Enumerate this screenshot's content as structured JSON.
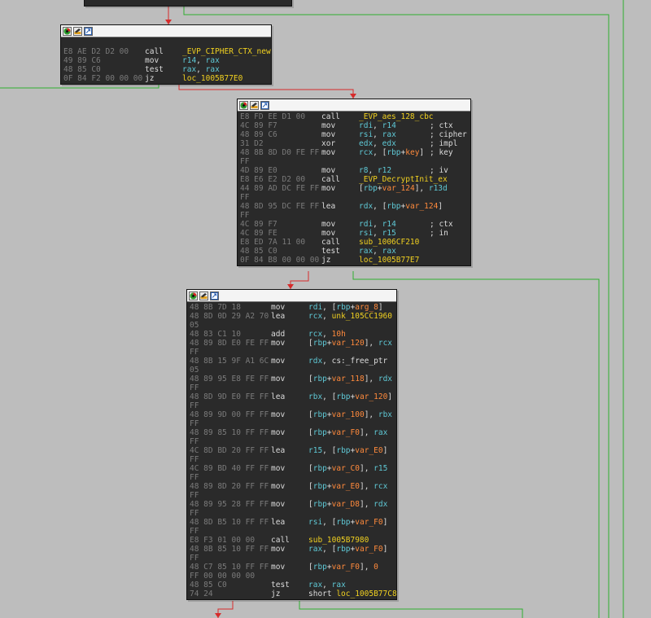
{
  "colors": {
    "background": "#bdbdbd",
    "node_bg": "#2a2a2a",
    "edge_true": "#2fae2f",
    "edge_false": "#d62b2b",
    "func": "#f0d020",
    "register": "#5fc9d6",
    "variable": "#ff8a3c",
    "bytes": "#7b7b7b"
  },
  "header_icons": [
    "color-node-icon",
    "rename-node-icon",
    "collapse-node-icon"
  ],
  "nodes": [
    {
      "lines": [
        {
          "b": "",
          "m": "",
          "o": [],
          "c": ""
        },
        {
          "b": "E8 AE D2 D2 00",
          "m": "call",
          "o": [
            {
              "t": "_EVP_CIPHER_CTX_new",
              "k": "func"
            }
          ],
          "c": ""
        },
        {
          "b": "49 89 C6",
          "m": "mov",
          "o": [
            {
              "t": "r14",
              "k": "reg"
            },
            {
              "t": ", ",
              "k": "text"
            },
            {
              "t": "rax",
              "k": "reg"
            }
          ],
          "c": ""
        },
        {
          "b": "48 85 C0",
          "m": "test",
          "o": [
            {
              "t": "rax",
              "k": "reg"
            },
            {
              "t": ", ",
              "k": "text"
            },
            {
              "t": "rax",
              "k": "reg"
            }
          ],
          "c": ""
        },
        {
          "b": "0F 84 F2 00 00 00",
          "m": "jz",
          "o": [
            {
              "t": "loc_1005B77E0",
              "k": "func"
            }
          ],
          "c": ""
        }
      ]
    },
    {
      "lines": [
        {
          "b": "E8 FD EE D1 00",
          "m": "call",
          "o": [
            {
              "t": "_EVP_aes_128_cbc",
              "k": "func"
            }
          ],
          "c": ""
        },
        {
          "b": "4C 89 F7",
          "m": "mov",
          "o": [
            {
              "t": "rdi",
              "k": "reg"
            },
            {
              "t": ", ",
              "k": "text"
            },
            {
              "t": "r14",
              "k": "reg"
            }
          ],
          "c": "; ctx"
        },
        {
          "b": "48 89 C6",
          "m": "mov",
          "o": [
            {
              "t": "rsi",
              "k": "reg"
            },
            {
              "t": ", ",
              "k": "text"
            },
            {
              "t": "rax",
              "k": "reg"
            }
          ],
          "c": "; cipher"
        },
        {
          "b": "31 D2",
          "m": "xor",
          "o": [
            {
              "t": "edx",
              "k": "reg"
            },
            {
              "t": ", ",
              "k": "text"
            },
            {
              "t": "edx",
              "k": "reg"
            }
          ],
          "c": "; impl"
        },
        {
          "b": "48 8B 8D D0 FE FF",
          "m": "mov",
          "o": [
            {
              "t": "rcx",
              "k": "reg"
            },
            {
              "t": ", [",
              "k": "text"
            },
            {
              "t": "rbp",
              "k": "reg"
            },
            {
              "t": "+",
              "k": "text"
            },
            {
              "t": "key",
              "k": "var"
            },
            {
              "t": "]",
              "k": "text"
            }
          ],
          "c": "; key"
        },
        {
          "b": "FF",
          "m": "",
          "o": [],
          "c": ""
        },
        {
          "b": "4D 89 E0",
          "m": "mov",
          "o": [
            {
              "t": "r8",
              "k": "reg"
            },
            {
              "t": ", ",
              "k": "text"
            },
            {
              "t": "r12",
              "k": "reg"
            }
          ],
          "c": "; iv"
        },
        {
          "b": "E8 E6 E2 D2 00",
          "m": "call",
          "o": [
            {
              "t": "_EVP_DecryptInit_ex",
              "k": "func"
            }
          ],
          "c": ""
        },
        {
          "b": "44 89 AD DC FE FF",
          "m": "mov",
          "o": [
            {
              "t": "[",
              "k": "text"
            },
            {
              "t": "rbp",
              "k": "reg"
            },
            {
              "t": "+",
              "k": "text"
            },
            {
              "t": "var_124",
              "k": "var"
            },
            {
              "t": "], ",
              "k": "text"
            },
            {
              "t": "r13d",
              "k": "reg"
            }
          ],
          "c": ""
        },
        {
          "b": "FF",
          "m": "",
          "o": [],
          "c": ""
        },
        {
          "b": "48 8D 95 DC FE FF",
          "m": "lea",
          "o": [
            {
              "t": "rdx",
              "k": "reg"
            },
            {
              "t": ", [",
              "k": "text"
            },
            {
              "t": "rbp",
              "k": "reg"
            },
            {
              "t": "+",
              "k": "text"
            },
            {
              "t": "var_124",
              "k": "var"
            },
            {
              "t": "]",
              "k": "text"
            }
          ],
          "c": ""
        },
        {
          "b": "FF",
          "m": "",
          "o": [],
          "c": ""
        },
        {
          "b": "4C 89 F7",
          "m": "mov",
          "o": [
            {
              "t": "rdi",
              "k": "reg"
            },
            {
              "t": ", ",
              "k": "text"
            },
            {
              "t": "r14",
              "k": "reg"
            }
          ],
          "c": "; ctx"
        },
        {
          "b": "4C 89 FE",
          "m": "mov",
          "o": [
            {
              "t": "rsi",
              "k": "reg"
            },
            {
              "t": ", ",
              "k": "text"
            },
            {
              "t": "r15",
              "k": "reg"
            }
          ],
          "c": "; in"
        },
        {
          "b": "E8 ED 7A 11 00",
          "m": "call",
          "o": [
            {
              "t": "sub_1006CF210",
              "k": "func"
            }
          ],
          "c": ""
        },
        {
          "b": "48 85 C0",
          "m": "test",
          "o": [
            {
              "t": "rax",
              "k": "reg"
            },
            {
              "t": ", ",
              "k": "text"
            },
            {
              "t": "rax",
              "k": "reg"
            }
          ],
          "c": ""
        },
        {
          "b": "0F 84 B8 00 00 00",
          "m": "jz",
          "o": [
            {
              "t": "loc_1005B77E7",
              "k": "func"
            }
          ],
          "c": ""
        }
      ]
    },
    {
      "lines": [
        {
          "b": "48 8B 7D 18",
          "m": "mov",
          "o": [
            {
              "t": "rdi",
              "k": "reg"
            },
            {
              "t": ", [",
              "k": "text"
            },
            {
              "t": "rbp",
              "k": "reg"
            },
            {
              "t": "+",
              "k": "text"
            },
            {
              "t": "arg_8",
              "k": "var"
            },
            {
              "t": "]",
              "k": "text"
            }
          ],
          "c": ""
        },
        {
          "b": "48 8D 0D 29 A2 70",
          "m": "lea",
          "o": [
            {
              "t": "rcx",
              "k": "reg"
            },
            {
              "t": ", ",
              "k": "text"
            },
            {
              "t": "unk_105CC1960",
              "k": "func"
            }
          ],
          "c": ""
        },
        {
          "b": "05",
          "m": "",
          "o": [],
          "c": ""
        },
        {
          "b": "48 83 C1 10",
          "m": "add",
          "o": [
            {
              "t": "rcx",
              "k": "reg"
            },
            {
              "t": ", ",
              "k": "text"
            },
            {
              "t": "10h",
              "k": "num"
            }
          ],
          "c": ""
        },
        {
          "b": "48 89 8D E0 FE FF",
          "m": "mov",
          "o": [
            {
              "t": "[",
              "k": "text"
            },
            {
              "t": "rbp",
              "k": "reg"
            },
            {
              "t": "+",
              "k": "text"
            },
            {
              "t": "var_120",
              "k": "var"
            },
            {
              "t": "], ",
              "k": "text"
            },
            {
              "t": "rcx",
              "k": "reg"
            }
          ],
          "c": ""
        },
        {
          "b": "FF",
          "m": "",
          "o": [],
          "c": ""
        },
        {
          "b": "48 8B 15 9F A1 6C",
          "m": "mov",
          "o": [
            {
              "t": "rdx",
              "k": "reg"
            },
            {
              "t": ", cs:_free_ptr",
              "k": "text"
            }
          ],
          "c": ""
        },
        {
          "b": "05",
          "m": "",
          "o": [],
          "c": ""
        },
        {
          "b": "48 89 95 E8 FE FF",
          "m": "mov",
          "o": [
            {
              "t": "[",
              "k": "text"
            },
            {
              "t": "rbp",
              "k": "reg"
            },
            {
              "t": "+",
              "k": "text"
            },
            {
              "t": "var_118",
              "k": "var"
            },
            {
              "t": "], ",
              "k": "text"
            },
            {
              "t": "rdx",
              "k": "reg"
            }
          ],
          "c": ""
        },
        {
          "b": "FF",
          "m": "",
          "o": [],
          "c": ""
        },
        {
          "b": "48 8D 9D E0 FE FF",
          "m": "lea",
          "o": [
            {
              "t": "rbx",
              "k": "reg"
            },
            {
              "t": ", [",
              "k": "text"
            },
            {
              "t": "rbp",
              "k": "reg"
            },
            {
              "t": "+",
              "k": "text"
            },
            {
              "t": "var_120",
              "k": "var"
            },
            {
              "t": "]",
              "k": "text"
            }
          ],
          "c": ""
        },
        {
          "b": "FF",
          "m": "",
          "o": [],
          "c": ""
        },
        {
          "b": "48 89 9D 00 FF FF",
          "m": "mov",
          "o": [
            {
              "t": "[",
              "k": "text"
            },
            {
              "t": "rbp",
              "k": "reg"
            },
            {
              "t": "+",
              "k": "text"
            },
            {
              "t": "var_100",
              "k": "var"
            },
            {
              "t": "], ",
              "k": "text"
            },
            {
              "t": "rbx",
              "k": "reg"
            }
          ],
          "c": ""
        },
        {
          "b": "FF",
          "m": "",
          "o": [],
          "c": ""
        },
        {
          "b": "48 89 85 10 FF FF",
          "m": "mov",
          "o": [
            {
              "t": "[",
              "k": "text"
            },
            {
              "t": "rbp",
              "k": "reg"
            },
            {
              "t": "+",
              "k": "text"
            },
            {
              "t": "var_F0",
              "k": "var"
            },
            {
              "t": "], ",
              "k": "text"
            },
            {
              "t": "rax",
              "k": "reg"
            }
          ],
          "c": ""
        },
        {
          "b": "FF",
          "m": "",
          "o": [],
          "c": ""
        },
        {
          "b": "4C 8D BD 20 FF FF",
          "m": "lea",
          "o": [
            {
              "t": "r15",
              "k": "reg"
            },
            {
              "t": ", [",
              "k": "text"
            },
            {
              "t": "rbp",
              "k": "reg"
            },
            {
              "t": "+",
              "k": "text"
            },
            {
              "t": "var_E0",
              "k": "var"
            },
            {
              "t": "]",
              "k": "text"
            }
          ],
          "c": ""
        },
        {
          "b": "FF",
          "m": "",
          "o": [],
          "c": ""
        },
        {
          "b": "4C 89 BD 40 FF FF",
          "m": "mov",
          "o": [
            {
              "t": "[",
              "k": "text"
            },
            {
              "t": "rbp",
              "k": "reg"
            },
            {
              "t": "+",
              "k": "text"
            },
            {
              "t": "var_C0",
              "k": "var"
            },
            {
              "t": "], ",
              "k": "text"
            },
            {
              "t": "r15",
              "k": "reg"
            }
          ],
          "c": ""
        },
        {
          "b": "FF",
          "m": "",
          "o": [],
          "c": ""
        },
        {
          "b": "48 89 8D 20 FF FF",
          "m": "mov",
          "o": [
            {
              "t": "[",
              "k": "text"
            },
            {
              "t": "rbp",
              "k": "reg"
            },
            {
              "t": "+",
              "k": "text"
            },
            {
              "t": "var_E0",
              "k": "var"
            },
            {
              "t": "], ",
              "k": "text"
            },
            {
              "t": "rcx",
              "k": "reg"
            }
          ],
          "c": ""
        },
        {
          "b": "FF",
          "m": "",
          "o": [],
          "c": ""
        },
        {
          "b": "48 89 95 28 FF FF",
          "m": "mov",
          "o": [
            {
              "t": "[",
              "k": "text"
            },
            {
              "t": "rbp",
              "k": "reg"
            },
            {
              "t": "+",
              "k": "text"
            },
            {
              "t": "var_D8",
              "k": "var"
            },
            {
              "t": "], ",
              "k": "text"
            },
            {
              "t": "rdx",
              "k": "reg"
            }
          ],
          "c": ""
        },
        {
          "b": "FF",
          "m": "",
          "o": [],
          "c": ""
        },
        {
          "b": "48 8D B5 10 FF FF",
          "m": "lea",
          "o": [
            {
              "t": "rsi",
              "k": "reg"
            },
            {
              "t": ", [",
              "k": "text"
            },
            {
              "t": "rbp",
              "k": "reg"
            },
            {
              "t": "+",
              "k": "text"
            },
            {
              "t": "var_F0",
              "k": "var"
            },
            {
              "t": "]",
              "k": "text"
            }
          ],
          "c": ""
        },
        {
          "b": "FF",
          "m": "",
          "o": [],
          "c": ""
        },
        {
          "b": "E8 F3 01 00 00",
          "m": "call",
          "o": [
            {
              "t": "sub_1005B7980",
              "k": "func"
            }
          ],
          "c": ""
        },
        {
          "b": "48 8B 85 10 FF FF",
          "m": "mov",
          "o": [
            {
              "t": "rax",
              "k": "reg"
            },
            {
              "t": ", [",
              "k": "text"
            },
            {
              "t": "rbp",
              "k": "reg"
            },
            {
              "t": "+",
              "k": "text"
            },
            {
              "t": "var_F0",
              "k": "var"
            },
            {
              "t": "]",
              "k": "text"
            }
          ],
          "c": ""
        },
        {
          "b": "FF",
          "m": "",
          "o": [],
          "c": ""
        },
        {
          "b": "48 C7 85 10 FF FF",
          "m": "mov",
          "o": [
            {
              "t": "[",
              "k": "text"
            },
            {
              "t": "rbp",
              "k": "reg"
            },
            {
              "t": "+",
              "k": "text"
            },
            {
              "t": "var_F0",
              "k": "var"
            },
            {
              "t": "], ",
              "k": "text"
            },
            {
              "t": "0",
              "k": "num"
            }
          ],
          "c": ""
        },
        {
          "b": "FF 00 00 00 00",
          "m": "",
          "o": [],
          "c": ""
        },
        {
          "b": "48 85 C0",
          "m": "test",
          "o": [
            {
              "t": "rax",
              "k": "reg"
            },
            {
              "t": ", ",
              "k": "text"
            },
            {
              "t": "rax",
              "k": "reg"
            }
          ],
          "c": ""
        },
        {
          "b": "74 24",
          "m": "jz",
          "o": [
            {
              "t": "short ",
              "k": "text"
            },
            {
              "t": "loc_1005B77C8",
              "k": "func"
            }
          ],
          "c": ""
        }
      ]
    }
  ]
}
